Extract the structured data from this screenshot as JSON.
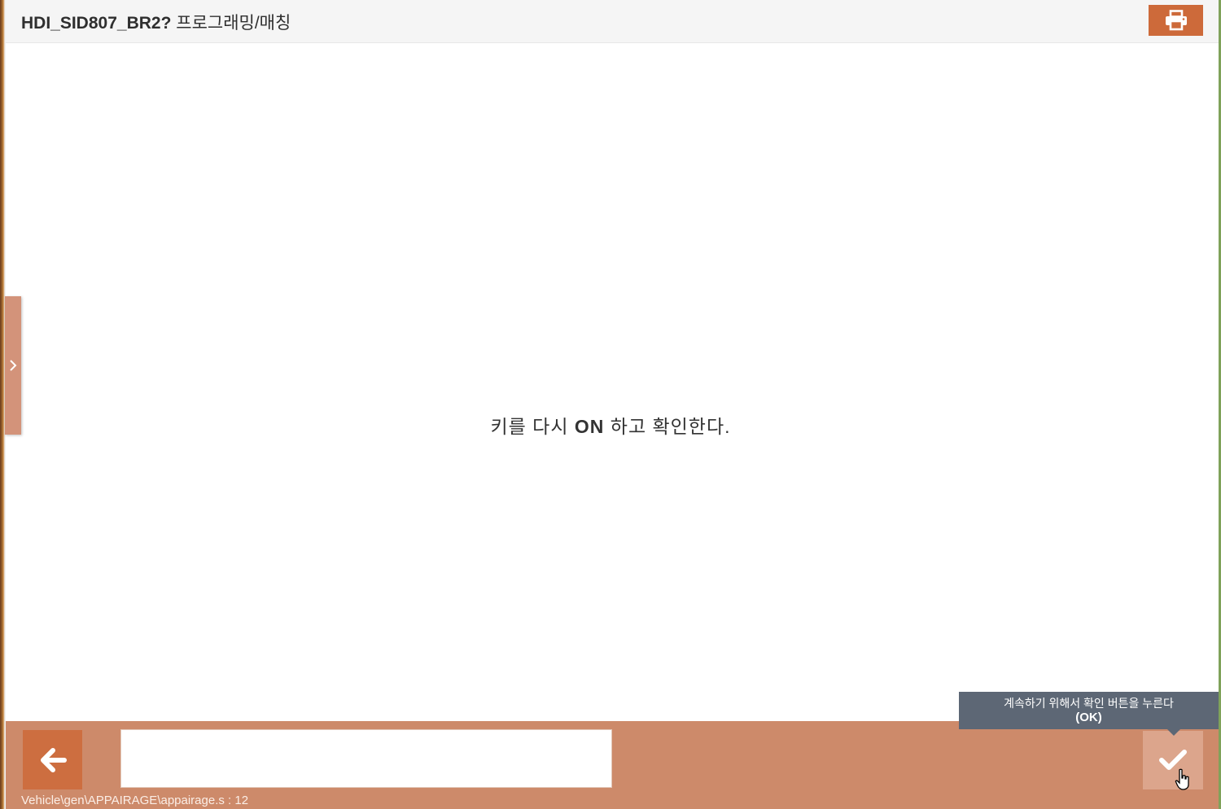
{
  "header": {
    "code": "HDI_SID807_BR2?",
    "title": "프로그래밍/매칭",
    "print_icon": "printer-icon"
  },
  "side_panel": {
    "toggle_icon": "chevron-right-icon"
  },
  "main": {
    "message_before": "키를 다시 ",
    "message_bold": "ON",
    "message_after": " 하고 확인한다."
  },
  "footer": {
    "back_icon": "arrow-left-icon",
    "input_value": "",
    "ok_icon": "checkmark-icon",
    "status_path": "Vehicle\\gen\\APPAIRAGE\\appairage.s : 12"
  },
  "tooltip": {
    "line1": "계속하기 위해서 확인 버튼을 누른다",
    "line2": "(OK)"
  },
  "colors": {
    "accent": "#cd6a3a",
    "footer_bg": "#cd8a6a",
    "side_tab": "#d3937a",
    "tooltip_bg": "#5d6775"
  }
}
